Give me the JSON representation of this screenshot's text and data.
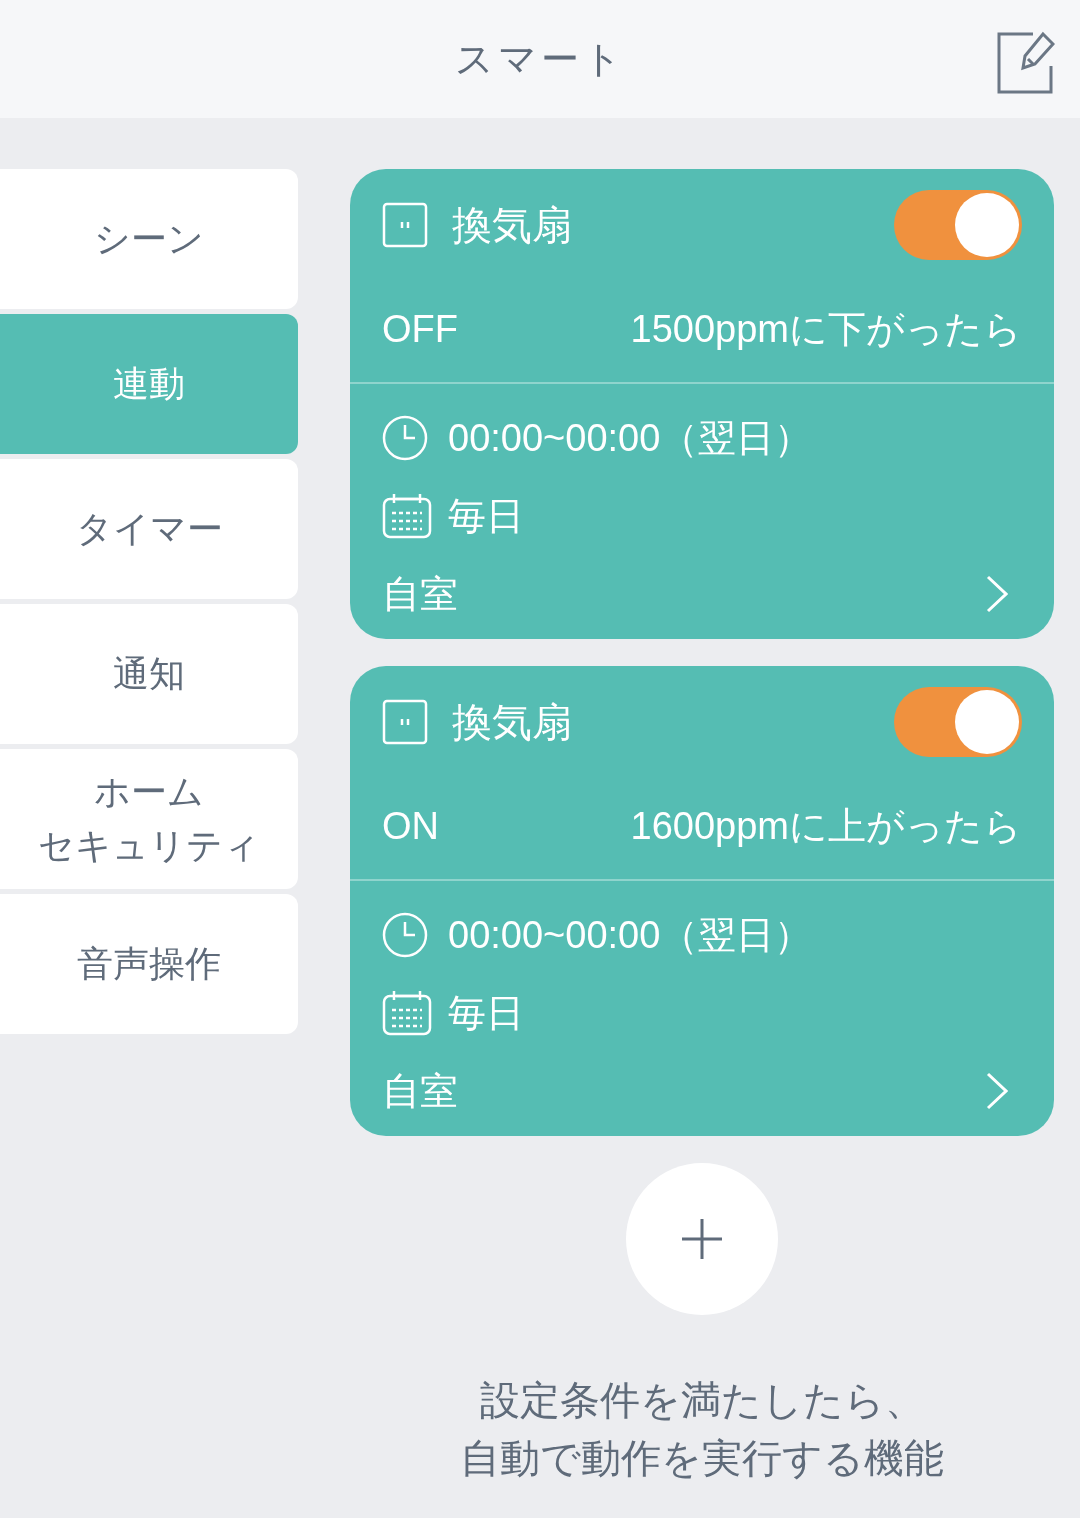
{
  "header": {
    "title": "スマート"
  },
  "sidebar": {
    "items": [
      {
        "label": "シーン",
        "selected": false
      },
      {
        "label": "連動",
        "selected": true
      },
      {
        "label": "タイマー",
        "selected": false
      },
      {
        "label": "通知",
        "selected": false
      },
      {
        "label": [
          "ホーム",
          "セキュリティ"
        ],
        "selected": false
      },
      {
        "label": "音声操作",
        "selected": false
      }
    ]
  },
  "rules": [
    {
      "device": "換気扇",
      "on": true,
      "state": "OFF",
      "condition": "1500ppmに下がったら",
      "time": "00:00~00:00（翌日）",
      "repeat": "毎日",
      "place": "自室"
    },
    {
      "device": "換気扇",
      "on": true,
      "state": "ON",
      "condition": "1600ppmに上がったら",
      "time": "00:00~00:00（翌日）",
      "repeat": "毎日",
      "place": "自室"
    }
  ],
  "caption": [
    "設定条件を満たしたら、",
    "自動で動作を実行する機能"
  ]
}
